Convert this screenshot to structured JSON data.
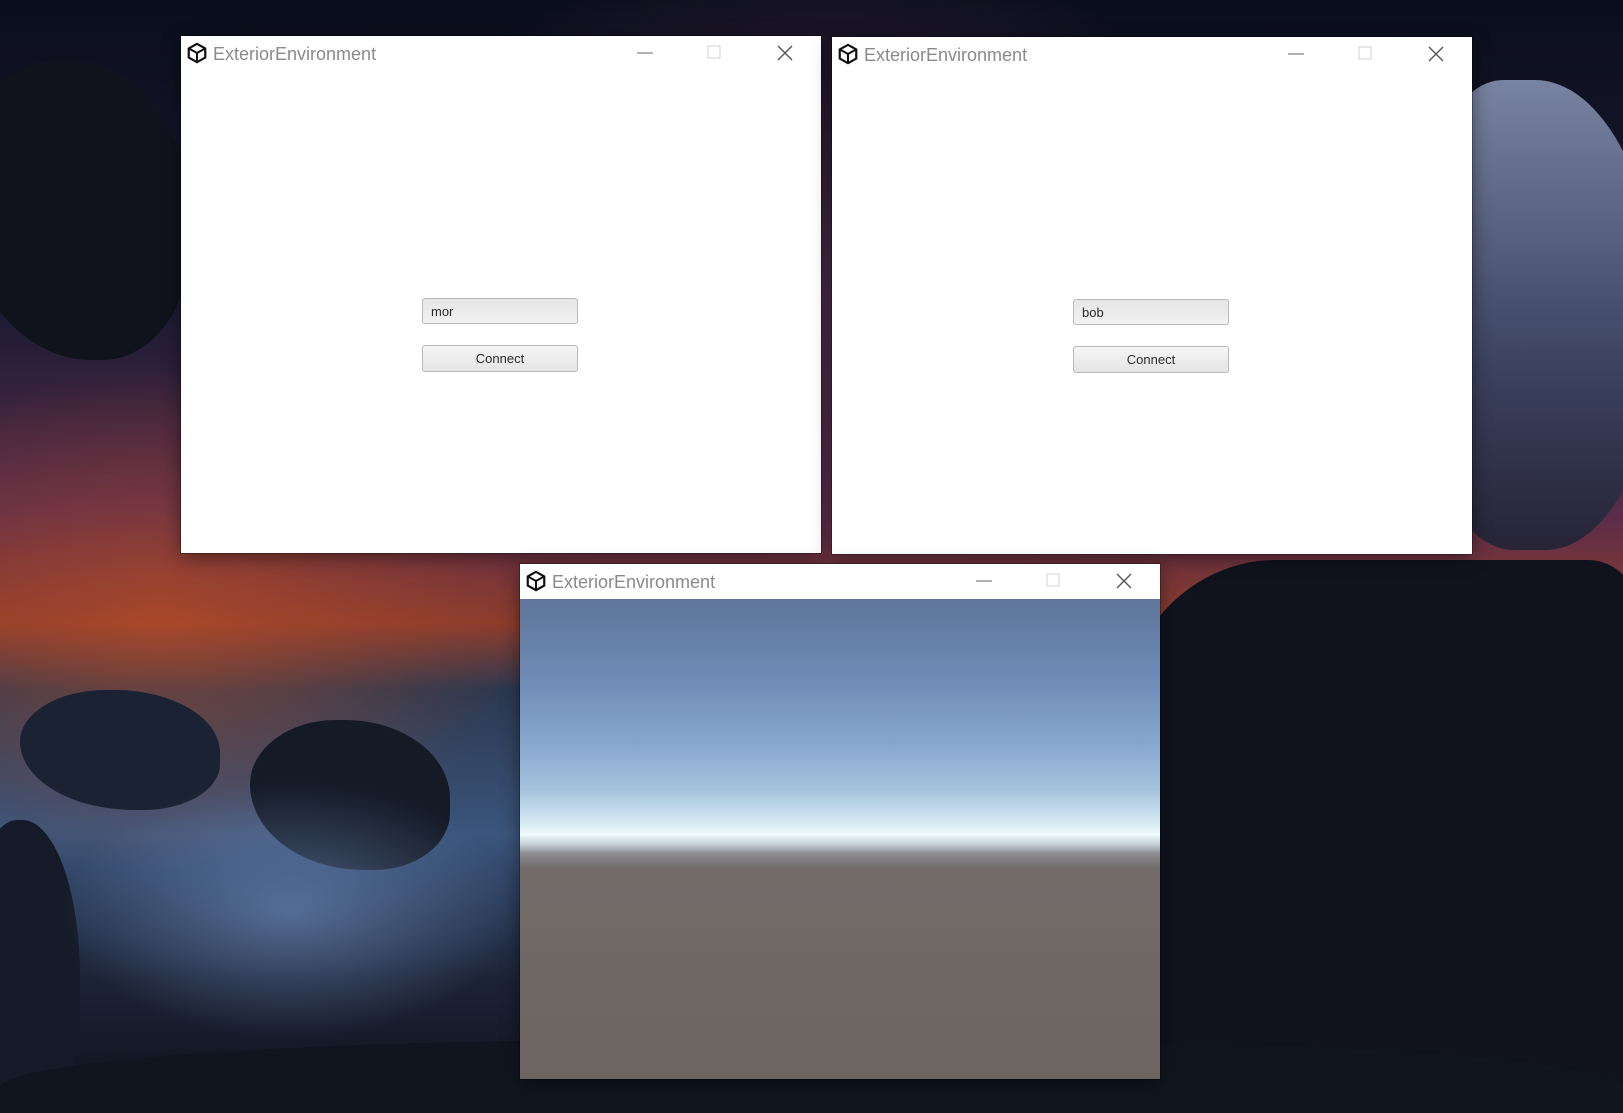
{
  "windows": [
    {
      "title": "ExteriorEnvironment",
      "name_input": {
        "value": "mor"
      },
      "connect_button": {
        "label": "Connect"
      }
    },
    {
      "title": "ExteriorEnvironment",
      "name_input": {
        "value": "bob"
      },
      "connect_button": {
        "label": "Connect"
      }
    },
    {
      "title": "ExteriorEnvironment",
      "scene": {
        "sky_color": "#6c89b3",
        "horizon_color": "#f0fbfd",
        "ground_color": "#6d6560"
      }
    }
  ],
  "icons": {
    "app": "unity-logo-icon",
    "minimize": "minimize-icon",
    "maximize": "maximize-icon",
    "close": "close-icon"
  }
}
